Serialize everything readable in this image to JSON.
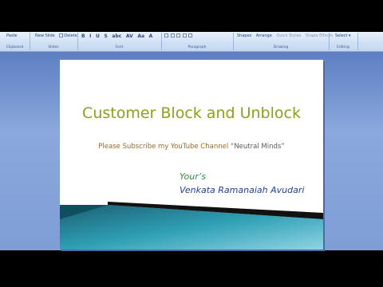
{
  "ribbon": {
    "clipboard": {
      "paste_label": "Paste",
      "group_label": "Clipboard"
    },
    "slides": {
      "new_slide_label": "New Slide",
      "delete_label": "Delete",
      "group_label": "Slides"
    },
    "font": {
      "group_label": "Font",
      "buttons": [
        "B",
        "I",
        "U",
        "S",
        "abc",
        "AV",
        "Aa",
        "A"
      ]
    },
    "paragraph": {
      "group_label": "Paragraph"
    },
    "drawing": {
      "shapes_label": "Shapes",
      "arrange_label": "Arrange",
      "quick_styles_label": "Quick Styles",
      "shape_effects_label": "Shape Effects",
      "group_label": "Drawing"
    },
    "editing": {
      "select_label": "Select",
      "group_label": "Editing"
    }
  },
  "slide": {
    "title": "Customer Block and Unblock",
    "subtitle_main": "Please Subscribe my YouTube Channel ",
    "subtitle_channel": "“Neutral Minds”",
    "signoff": "Your’s",
    "author": "Venkata Ramanaiah  Avudari"
  },
  "colors": {
    "title": "#8aa21a",
    "subtitle": "#9a6a23",
    "signoff": "#2f8f3f",
    "author": "#1f3f93",
    "swoosh_teal": "#2f9fb5",
    "swoosh_dark": "#1c5f72"
  }
}
